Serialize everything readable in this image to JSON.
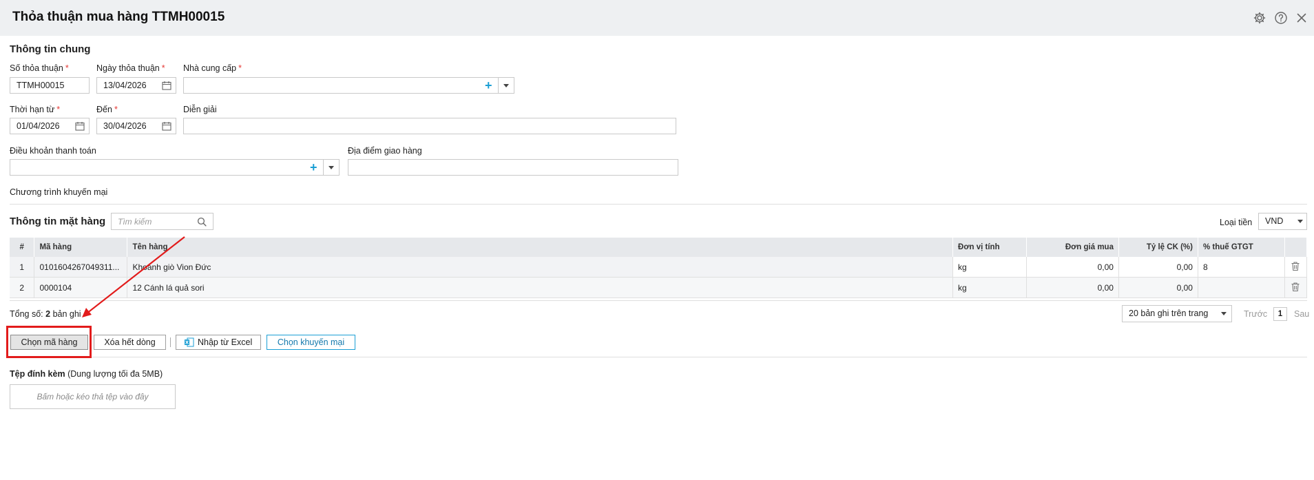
{
  "header": {
    "title": "Thỏa thuận mua hàng TTMH00015"
  },
  "icons": {
    "settings": "gear-icon",
    "help": "help-icon",
    "close": "close-icon"
  },
  "general": {
    "section_title": "Thông tin chung",
    "so_thoa_thuan": {
      "label": "Số thỏa thuận",
      "value": "TTMH00015"
    },
    "ngay_thoa_thuan": {
      "label": "Ngày thỏa thuận",
      "value": "13/04/2026"
    },
    "nha_cung_cap": {
      "label": "Nhà cung cấp",
      "value": ""
    },
    "thoi_han_tu": {
      "label": "Thời hạn từ",
      "value": "01/04/2026"
    },
    "den": {
      "label": "Đến",
      "value": "30/04/2026"
    },
    "dien_giai": {
      "label": "Diễn giải",
      "value": ""
    },
    "dieu_khoan": {
      "label": "Điều khoản thanh toán",
      "value": ""
    },
    "dia_diem": {
      "label": "Địa điểm giao hàng",
      "value": ""
    },
    "khuyen_mai": {
      "label": "Chương trình khuyến mại"
    },
    "required_mark": "*"
  },
  "items": {
    "section_title": "Thông tin mặt hàng",
    "search_placeholder": "Tìm kiếm",
    "currency_label": "Loại tiền",
    "currency_value": "VND",
    "columns": [
      "#",
      "Mã hàng",
      "Tên hàng",
      "Đơn vị tính",
      "Đơn giá mua",
      "Tỷ lệ CK (%)",
      "% thuế GTGT"
    ],
    "rows": [
      {
        "no": "1",
        "code": "0101604267049311...",
        "name": "Khoanh giò Vion Đức",
        "unit": "kg",
        "price": "0,00",
        "discount": "0,00",
        "vat": "8"
      },
      {
        "no": "2",
        "code": "0000104",
        "name": "12 Cánh lá quả sori",
        "unit": "kg",
        "price": "0,00",
        "discount": "0,00",
        "vat": ""
      }
    ],
    "total_prefix": "Tổng số:",
    "total_count": "2",
    "total_suffix": "bản ghi",
    "page_size": "20 bản ghi trên trang",
    "prev": "Trước",
    "page": "1",
    "next": "Sau"
  },
  "actions": {
    "chon_ma_hang": "Chọn mã hàng",
    "xoa_het_dong": "Xóa hết dòng",
    "nhap_tu_excel": "Nhập từ Excel",
    "chon_khuyen_mai": "Chọn khuyến mại"
  },
  "attachments": {
    "title": "Tệp đính kèm",
    "note": "(Dung lượng tối đa 5MB)",
    "dropzone": "Bấm hoặc kéo thả tệp vào đây"
  },
  "colors": {
    "accent": "#1a9ed4",
    "required": "#e53935",
    "annotation": "#e21b1b"
  }
}
